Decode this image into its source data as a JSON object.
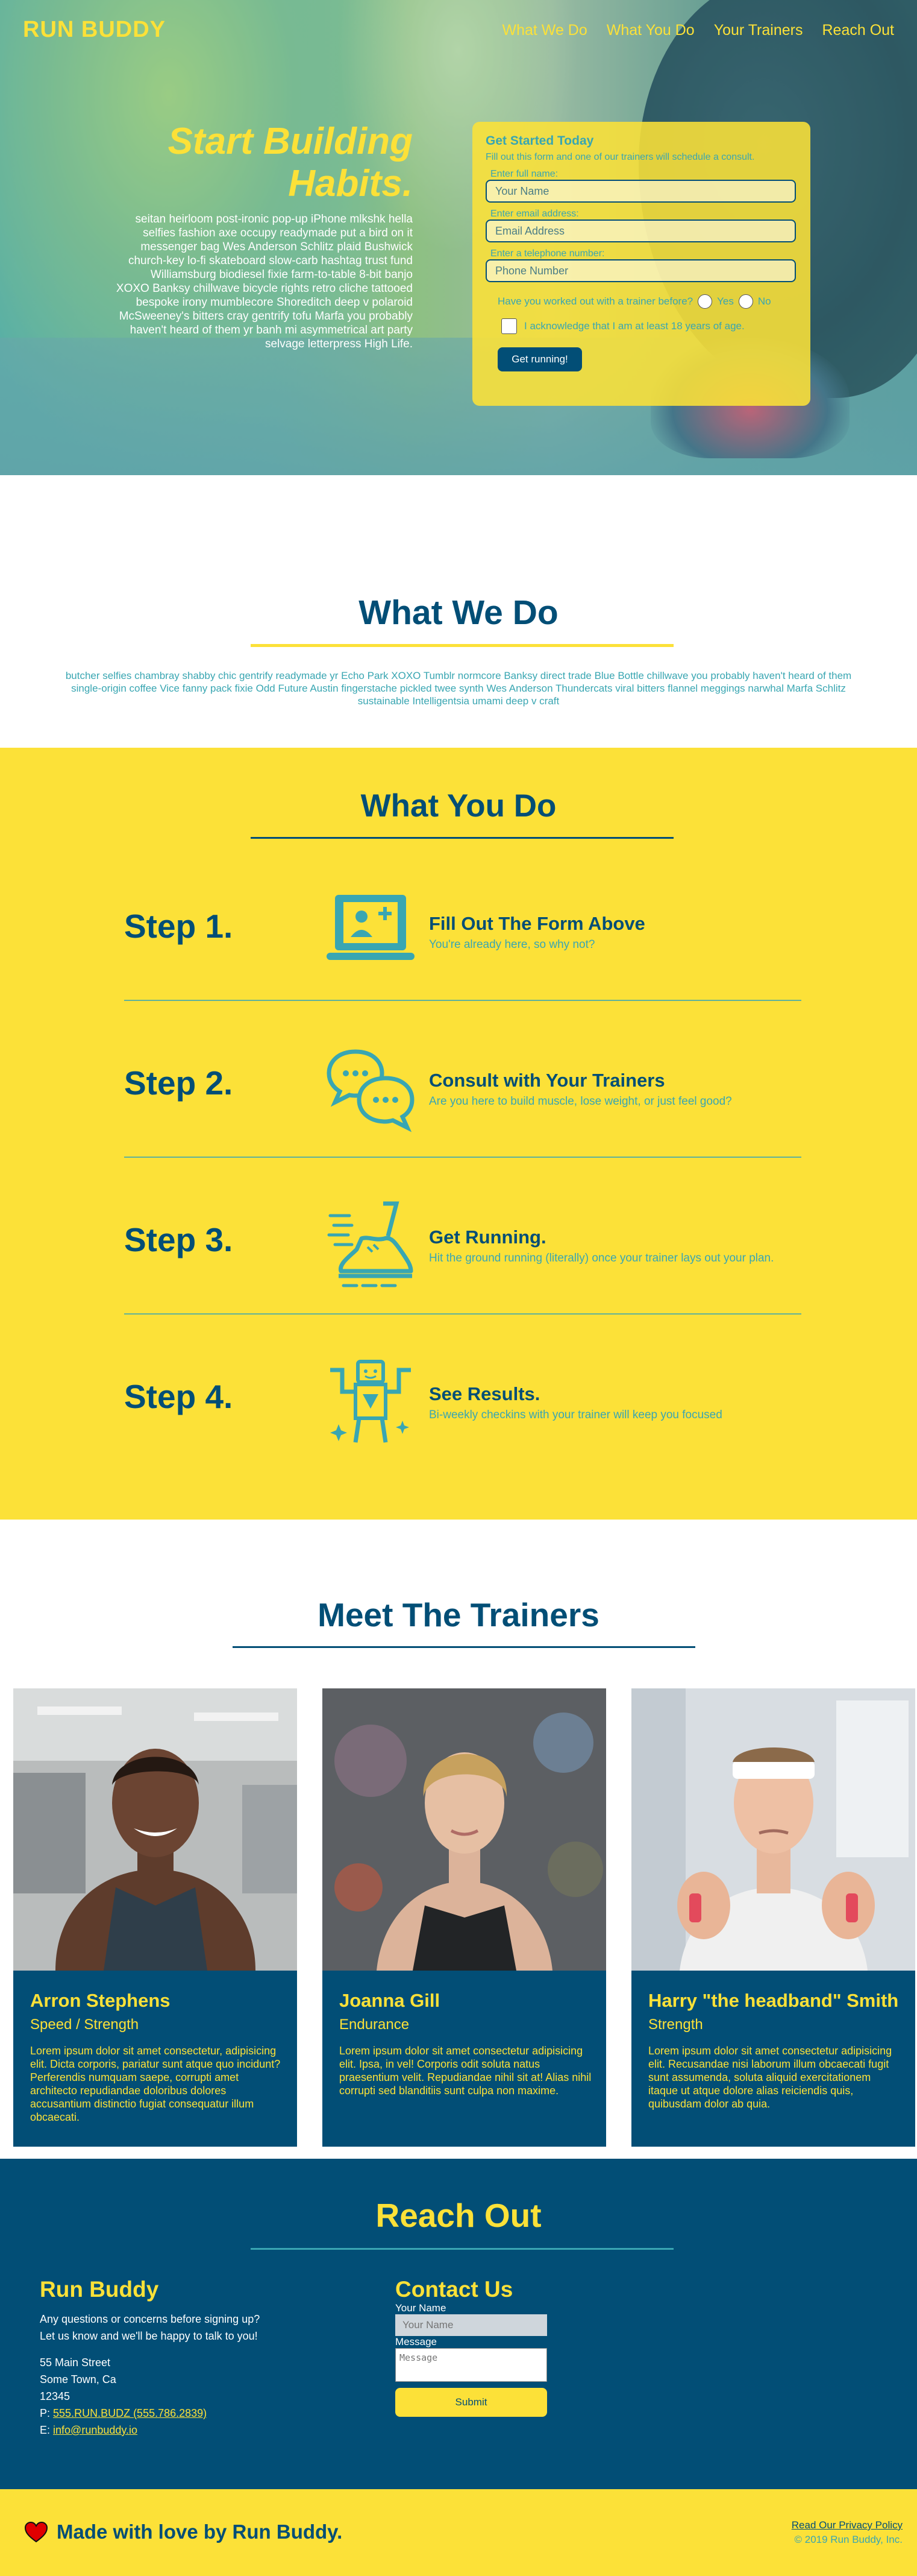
{
  "header": {
    "brand": "RUN BUDDY",
    "nav": [
      "What We Do",
      "What You Do",
      "Your Trainers",
      "Reach Out"
    ]
  },
  "hero": {
    "title": "Start Building Habits.",
    "body": "seitan heirloom post-ironic pop-up iPhone mlkshk hella selfies fashion axe occupy readymade put a bird on it messenger bag Wes Anderson Schlitz plaid Bushwick church-key lo-fi skateboard slow-carb hashtag trust fund Williamsburg biodiesel fixie farm-to-table 8-bit banjo XOXO Banksy chillwave bicycle rights retro cliche tattooed bespoke irony mumblecore Shoreditch deep v polaroid McSweeney's bitters cray gentrify tofu Marfa you probably haven't heard of them yr banh mi asymmetrical art party selvage letterpress High Life."
  },
  "signup_form": {
    "title": "Get Started Today",
    "lede": "Fill out this form and one of our trainers will schedule a consult.",
    "name_label": "Enter full name:",
    "name_placeholder": "Your Name",
    "email_label": "Enter email address:",
    "email_placeholder": "Email Address",
    "phone_label": "Enter a telephone number:",
    "phone_placeholder": "Phone Number",
    "question": "Have you worked out with a trainer before?",
    "yes": "Yes",
    "no": "No",
    "ack": "I acknowledge that I am at least 18 years of age.",
    "submit": "Get running!"
  },
  "what_we_do": {
    "title": "What We Do",
    "body": "butcher selfies chambray shabby chic gentrify readymade yr Echo Park XOXO Tumblr normcore Banksy direct trade Blue Bottle chillwave you probably haven't heard of them single-origin coffee Vice fanny pack fixie Odd Future Austin fingerstache pickled twee synth Wes Anderson Thundercats viral bitters flannel meggings narwhal Marfa Schlitz sustainable Intelligentsia umami deep v craft"
  },
  "what_you_do": {
    "title": "What You Do",
    "steps": [
      {
        "num": "Step 1.",
        "title": "Fill Out The Form Above",
        "desc": "You're already here, so why not?",
        "icon": "laptop-add-user-icon"
      },
      {
        "num": "Step 2.",
        "title": "Consult with Your Trainers",
        "desc": "Are you here to build muscle, lose weight, or just feel good?",
        "icon": "chat-bubbles-icon"
      },
      {
        "num": "Step 3.",
        "title": "Get Running.",
        "desc": "Hit the ground running (literally) once your trainer lays out your plan.",
        "icon": "running-shoe-icon"
      },
      {
        "num": "Step 4.",
        "title": "See Results.",
        "desc": "Bi-weekly checkins with your trainer will keep you focused",
        "icon": "strong-robot-icon"
      }
    ]
  },
  "trainers": {
    "title": "Meet The Trainers",
    "people": [
      {
        "name": "Arron Stephens",
        "role": "Speed / Strength",
        "bio": "Lorem ipsum dolor sit amet consectetur, adipisicing elit. Dicta corporis, pariatur sunt atque quo incidunt? Perferendis numquam saepe, corrupti amet architecto repudiandae doloribus dolores accusantium distinctio fugiat consequatur illum obcaecati."
      },
      {
        "name": "Joanna Gill",
        "role": "Endurance",
        "bio": "Lorem ipsum dolor sit amet consectetur adipisicing elit. Ipsa, in vel! Corporis odit soluta natus praesentium velit. Repudiandae nihil sit at! Alias nihil corrupti sed blanditiis sunt culpa non maxime."
      },
      {
        "name": "Harry \"the headband\" Smith",
        "role": "Strength",
        "bio": "Lorem ipsum dolor sit amet consectetur adipisicing elit. Recusandae nisi laborum illum obcaecati fugit sunt assumenda, soluta aliquid exercitationem itaque ut atque dolore alias reiciendis quis, quibusdam dolor ab quia."
      }
    ]
  },
  "reach_out": {
    "title": "Reach Out",
    "brand": "Run Buddy",
    "intro_1": "Any questions or concerns before signing up?",
    "intro_2": "Let us know and we'll be happy to talk to you!",
    "street": "55 Main Street",
    "city": "Some Town, Ca",
    "zip": "12345",
    "phone_prefix": "P:",
    "phone": "555.RUN.BUDZ (555.786.2839)",
    "email_prefix": "E:",
    "email": "info@runbuddy.io",
    "contact_title": "Contact Us",
    "name_label": "Your Name",
    "name_placeholder": "Your Name",
    "message_label": "Message",
    "message_placeholder": "Message",
    "submit": "Submit"
  },
  "footer": {
    "love": "Made with love by Run Buddy.",
    "privacy": "Read Our Privacy Policy",
    "copyright": "© 2019 Run Buddy, Inc."
  },
  "colors": {
    "navy": "#024e76",
    "yellow": "#fce138",
    "teal": "#39a6b2",
    "heart": "#e00000"
  }
}
